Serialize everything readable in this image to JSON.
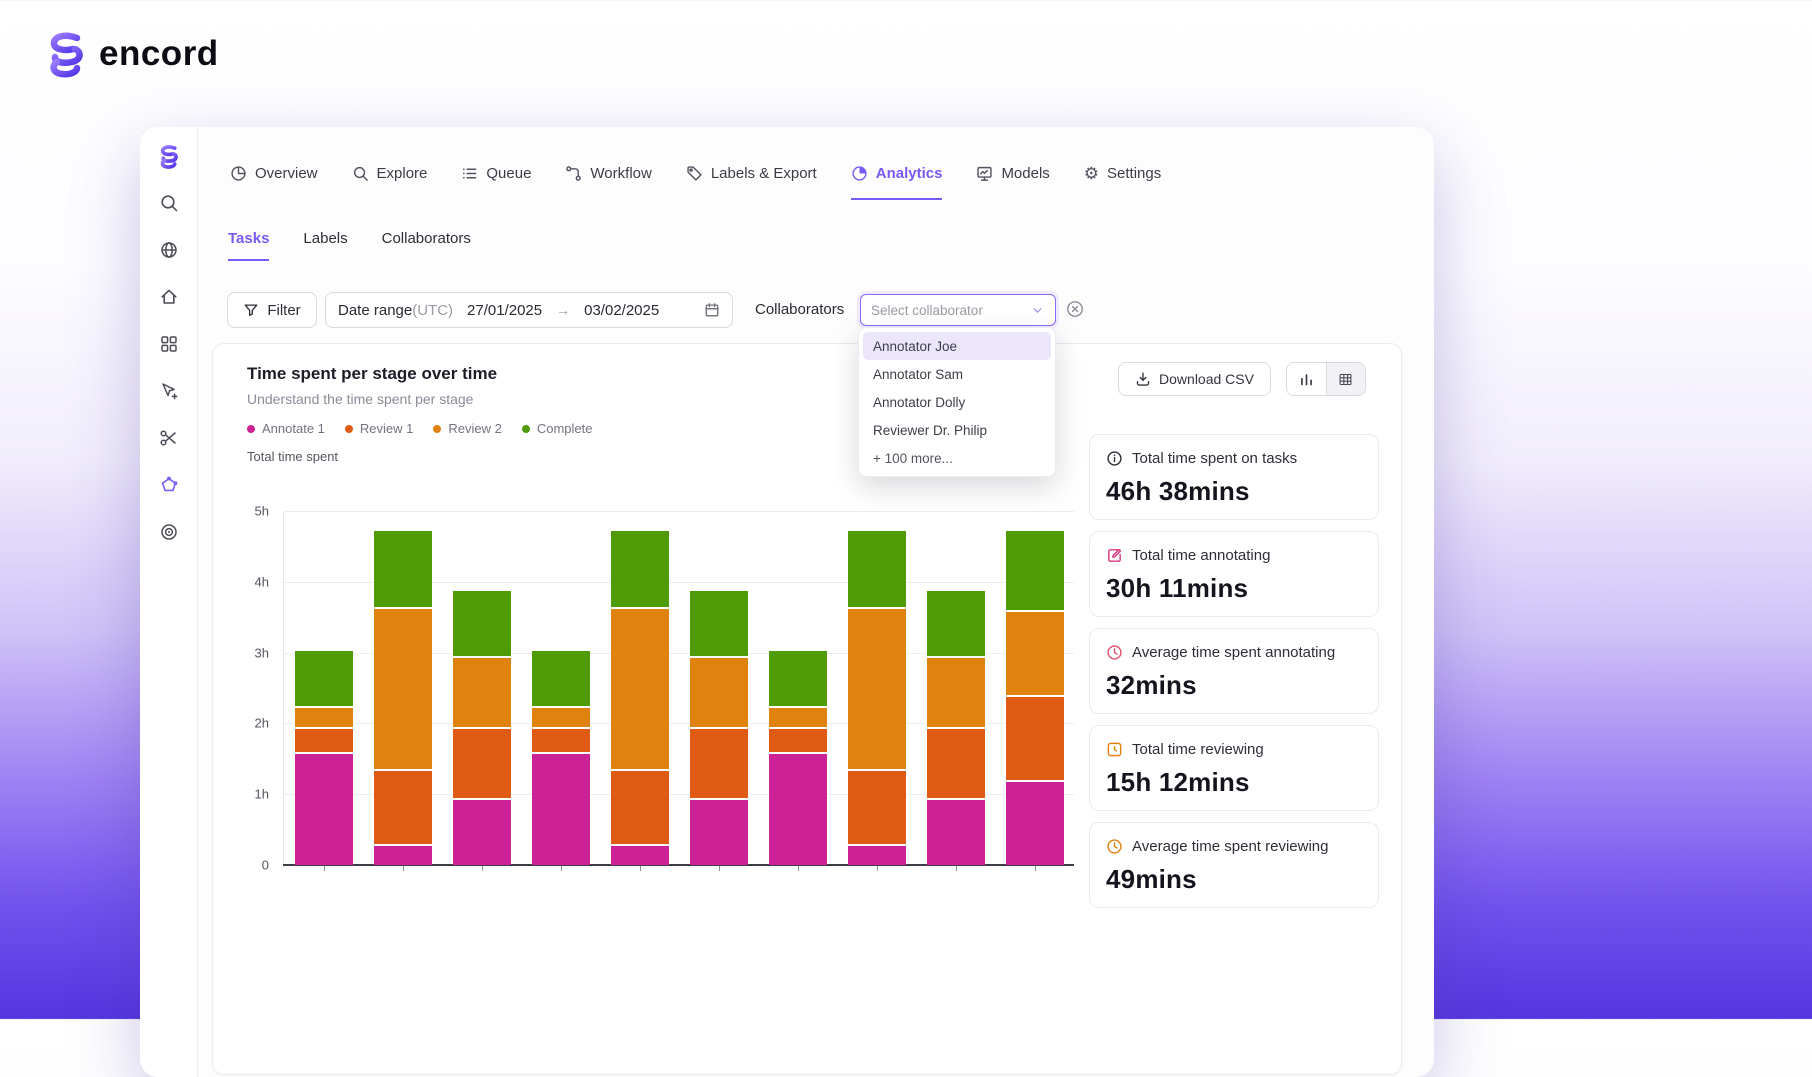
{
  "brand": {
    "wordmark": "encord"
  },
  "nav": {
    "items": [
      "Overview",
      "Explore",
      "Queue",
      "Workflow",
      "Labels & Export",
      "Analytics",
      "Models",
      "Settings"
    ],
    "active": "Analytics"
  },
  "subtabs": {
    "items": [
      "Tasks",
      "Labels",
      "Collaborators"
    ],
    "active": "Tasks"
  },
  "filters": {
    "filter_label": "Filter",
    "date_range": {
      "label": "Date range",
      "suffix": "(UTC)",
      "start": "27/01/2025",
      "end": "03/02/2025"
    },
    "collaborators_label": "Collaborators",
    "select_placeholder": "Select collaborator",
    "dropdown_items": [
      "Annotator Joe",
      "Annotator Sam",
      "Annotator Dolly",
      "Reviewer Dr. Philip",
      "+ 100 more..."
    ],
    "dropdown_active": "Annotator Joe"
  },
  "chart_card": {
    "title": "Time spent per stage over time",
    "subtitle": "Understand the time spent per stage",
    "download_label": "Download CSV",
    "y_axis_title": "Total time spent"
  },
  "chart_data": {
    "type": "bar",
    "stacked": true,
    "title": "Time spent per stage over time",
    "ylabel": "Total time spent",
    "unit": "hours",
    "ylim": [
      0,
      5
    ],
    "grid": true,
    "legend_position": "top-left",
    "y_ticks": [
      {
        "value": 0,
        "label": "0"
      },
      {
        "value": 1,
        "label": "1h"
      },
      {
        "value": 2,
        "label": "2h"
      },
      {
        "value": 3,
        "label": "3h"
      },
      {
        "value": 4,
        "label": "4h"
      },
      {
        "value": 5,
        "label": "5h"
      }
    ],
    "x_tick_labels": [],
    "series": [
      {
        "name": "Annotate 1",
        "color": "#cc2295",
        "values": [
          1.6,
          0.3,
          0.95,
          1.6,
          0.3,
          0.95,
          1.6,
          0.3,
          0.95,
          1.2
        ]
      },
      {
        "name": "Review 1",
        "color": "#df5b14",
        "values": [
          0.35,
          1.05,
          1.0,
          0.35,
          1.05,
          1.0,
          0.35,
          1.05,
          1.0,
          1.2
        ]
      },
      {
        "name": "Review 2",
        "color": "#e0820e",
        "values": [
          0.3,
          2.3,
          1.0,
          0.3,
          2.3,
          1.0,
          0.3,
          2.3,
          1.0,
          1.2
        ]
      },
      {
        "name": "Complete",
        "color": "#4f9b06",
        "values": [
          0.8,
          1.1,
          0.95,
          0.8,
          1.1,
          0.95,
          0.8,
          1.1,
          0.95,
          1.15
        ]
      }
    ]
  },
  "stats": [
    {
      "label": "Total time spent on tasks",
      "value": "46h 38mins"
    },
    {
      "label": "Total time annotating",
      "value": "30h 11mins"
    },
    {
      "label": "Average time spent annotating",
      "value": "32mins"
    },
    {
      "label": "Total time reviewing",
      "value": "15h 12mins"
    },
    {
      "label": "Average time spent reviewing",
      "value": "49mins"
    }
  ],
  "colors": {
    "accent": "#7a5af5",
    "select_border": "#8a68fa",
    "dropdown_highlight": "#ece6fd"
  },
  "icons": {
    "settings_gear": "⚙",
    "arrow_right": "→"
  }
}
